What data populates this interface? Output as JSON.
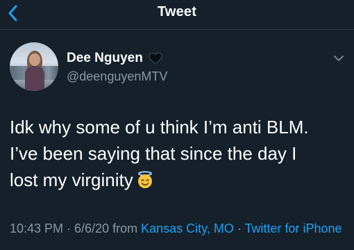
{
  "header": {
    "title": "Tweet",
    "back_icon": "chevron-left-icon"
  },
  "author": {
    "name": "Dee Nguyen",
    "handle": "@deenguyenMTV",
    "badge_icon": "black-heart-icon",
    "menu_icon": "chevron-down-icon"
  },
  "tweet": {
    "lines": [
      "Idk why some of u think I’m anti BLM.",
      "I’ve been saying that since the day I",
      "lost my virginity"
    ],
    "emoji": "smiling-face-with-halo-icon"
  },
  "meta": {
    "time": "10:43 PM",
    "sep1": " · ",
    "date": "6/6/20",
    "from": " from ",
    "location": "Kansas City, MO",
    "sep2": " · ",
    "client": "Twitter for iPhone"
  },
  "colors": {
    "background": "#15202b",
    "accent": "#1da1f2",
    "secondary_text": "#8899a6"
  }
}
